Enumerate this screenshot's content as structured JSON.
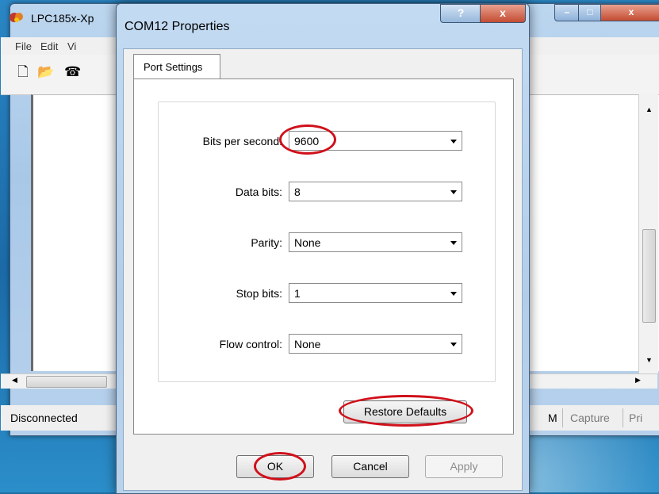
{
  "background_window": {
    "title": "LPC185x-Xp",
    "menu": [
      "File",
      "Edit",
      "Vi"
    ],
    "toolbar_icons": [
      "new-file-icon",
      "open-folder-icon",
      "phone-icon"
    ],
    "status": {
      "connection": "Disconnected",
      "col_m": "M",
      "capture": "Capture",
      "print": "Pri"
    }
  },
  "dialog": {
    "title": "COM12 Properties",
    "help_symbol": "?",
    "close_symbol": "x",
    "tab": "Port Settings",
    "fields": [
      {
        "label": "Bits per second:",
        "value": "9600"
      },
      {
        "label": "Data bits:",
        "value": "8"
      },
      {
        "label": "Parity:",
        "value": "None"
      },
      {
        "label": "Stop bits:",
        "value": "1"
      },
      {
        "label": "Flow control:",
        "value": "None"
      }
    ],
    "restore_defaults": "Restore Defaults",
    "ok": "OK",
    "cancel": "Cancel",
    "apply": "Apply"
  },
  "colors": {
    "annotation_red": "#d0101a",
    "title_bar": "#b3cde9"
  }
}
